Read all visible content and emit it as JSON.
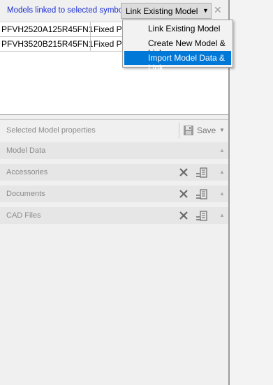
{
  "top_panel": {
    "title": "Models linked to selected symbol",
    "link_button_label": "Link Existing Model",
    "close_glyph": "✕",
    "dropdown_glyph": "▼",
    "rows": [
      {
        "name": "PFVH2520A125R45FN1",
        "type": "Fixed  Pu"
      },
      {
        "name": "PFVH3520B215R45FN1",
        "type": "Fixed  Pu"
      }
    ]
  },
  "dropdown_menu": {
    "items": [
      {
        "label": "Link Existing Model",
        "active": false
      },
      {
        "label": "Create New Model & Link",
        "active": false
      },
      {
        "label": "Import Model Data & Link",
        "active": true
      }
    ],
    "highlight_color": "#0078d7"
  },
  "properties": {
    "title": "Selected Model properties",
    "save_label": "Save",
    "save_dropdown_glyph": "▼",
    "collapse_glyph": "▲",
    "sections": [
      {
        "label": "Model Data",
        "has_actions": false
      },
      {
        "label": "Accessories",
        "has_actions": true
      },
      {
        "label": "Documents",
        "has_actions": true
      },
      {
        "label": "CAD Files",
        "has_actions": true
      }
    ]
  },
  "colors": {
    "title_blue": "#1a2ed1",
    "panel_bg": "#f0f0f0",
    "section_bg": "#e6e6e6",
    "muted_text": "#8a8a8a"
  }
}
